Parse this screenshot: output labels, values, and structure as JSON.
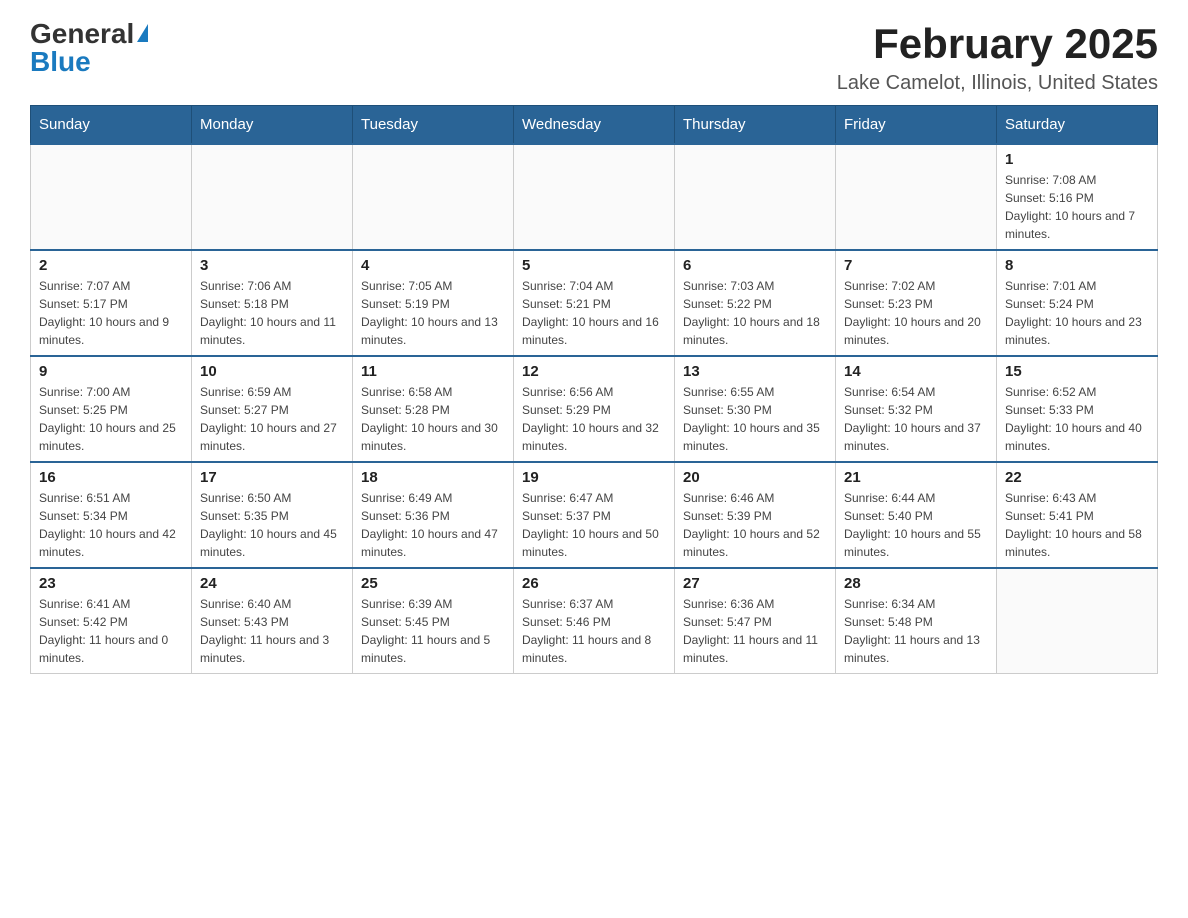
{
  "header": {
    "logo_general": "General",
    "logo_blue": "Blue",
    "title": "February 2025",
    "subtitle": "Lake Camelot, Illinois, United States"
  },
  "days_of_week": [
    "Sunday",
    "Monday",
    "Tuesday",
    "Wednesday",
    "Thursday",
    "Friday",
    "Saturday"
  ],
  "weeks": [
    [
      {
        "num": "",
        "info": ""
      },
      {
        "num": "",
        "info": ""
      },
      {
        "num": "",
        "info": ""
      },
      {
        "num": "",
        "info": ""
      },
      {
        "num": "",
        "info": ""
      },
      {
        "num": "",
        "info": ""
      },
      {
        "num": "1",
        "info": "Sunrise: 7:08 AM\nSunset: 5:16 PM\nDaylight: 10 hours and 7 minutes."
      }
    ],
    [
      {
        "num": "2",
        "info": "Sunrise: 7:07 AM\nSunset: 5:17 PM\nDaylight: 10 hours and 9 minutes."
      },
      {
        "num": "3",
        "info": "Sunrise: 7:06 AM\nSunset: 5:18 PM\nDaylight: 10 hours and 11 minutes."
      },
      {
        "num": "4",
        "info": "Sunrise: 7:05 AM\nSunset: 5:19 PM\nDaylight: 10 hours and 13 minutes."
      },
      {
        "num": "5",
        "info": "Sunrise: 7:04 AM\nSunset: 5:21 PM\nDaylight: 10 hours and 16 minutes."
      },
      {
        "num": "6",
        "info": "Sunrise: 7:03 AM\nSunset: 5:22 PM\nDaylight: 10 hours and 18 minutes."
      },
      {
        "num": "7",
        "info": "Sunrise: 7:02 AM\nSunset: 5:23 PM\nDaylight: 10 hours and 20 minutes."
      },
      {
        "num": "8",
        "info": "Sunrise: 7:01 AM\nSunset: 5:24 PM\nDaylight: 10 hours and 23 minutes."
      }
    ],
    [
      {
        "num": "9",
        "info": "Sunrise: 7:00 AM\nSunset: 5:25 PM\nDaylight: 10 hours and 25 minutes."
      },
      {
        "num": "10",
        "info": "Sunrise: 6:59 AM\nSunset: 5:27 PM\nDaylight: 10 hours and 27 minutes."
      },
      {
        "num": "11",
        "info": "Sunrise: 6:58 AM\nSunset: 5:28 PM\nDaylight: 10 hours and 30 minutes."
      },
      {
        "num": "12",
        "info": "Sunrise: 6:56 AM\nSunset: 5:29 PM\nDaylight: 10 hours and 32 minutes."
      },
      {
        "num": "13",
        "info": "Sunrise: 6:55 AM\nSunset: 5:30 PM\nDaylight: 10 hours and 35 minutes."
      },
      {
        "num": "14",
        "info": "Sunrise: 6:54 AM\nSunset: 5:32 PM\nDaylight: 10 hours and 37 minutes."
      },
      {
        "num": "15",
        "info": "Sunrise: 6:52 AM\nSunset: 5:33 PM\nDaylight: 10 hours and 40 minutes."
      }
    ],
    [
      {
        "num": "16",
        "info": "Sunrise: 6:51 AM\nSunset: 5:34 PM\nDaylight: 10 hours and 42 minutes."
      },
      {
        "num": "17",
        "info": "Sunrise: 6:50 AM\nSunset: 5:35 PM\nDaylight: 10 hours and 45 minutes."
      },
      {
        "num": "18",
        "info": "Sunrise: 6:49 AM\nSunset: 5:36 PM\nDaylight: 10 hours and 47 minutes."
      },
      {
        "num": "19",
        "info": "Sunrise: 6:47 AM\nSunset: 5:37 PM\nDaylight: 10 hours and 50 minutes."
      },
      {
        "num": "20",
        "info": "Sunrise: 6:46 AM\nSunset: 5:39 PM\nDaylight: 10 hours and 52 minutes."
      },
      {
        "num": "21",
        "info": "Sunrise: 6:44 AM\nSunset: 5:40 PM\nDaylight: 10 hours and 55 minutes."
      },
      {
        "num": "22",
        "info": "Sunrise: 6:43 AM\nSunset: 5:41 PM\nDaylight: 10 hours and 58 minutes."
      }
    ],
    [
      {
        "num": "23",
        "info": "Sunrise: 6:41 AM\nSunset: 5:42 PM\nDaylight: 11 hours and 0 minutes."
      },
      {
        "num": "24",
        "info": "Sunrise: 6:40 AM\nSunset: 5:43 PM\nDaylight: 11 hours and 3 minutes."
      },
      {
        "num": "25",
        "info": "Sunrise: 6:39 AM\nSunset: 5:45 PM\nDaylight: 11 hours and 5 minutes."
      },
      {
        "num": "26",
        "info": "Sunrise: 6:37 AM\nSunset: 5:46 PM\nDaylight: 11 hours and 8 minutes."
      },
      {
        "num": "27",
        "info": "Sunrise: 6:36 AM\nSunset: 5:47 PM\nDaylight: 11 hours and 11 minutes."
      },
      {
        "num": "28",
        "info": "Sunrise: 6:34 AM\nSunset: 5:48 PM\nDaylight: 11 hours and 13 minutes."
      },
      {
        "num": "",
        "info": ""
      }
    ]
  ]
}
